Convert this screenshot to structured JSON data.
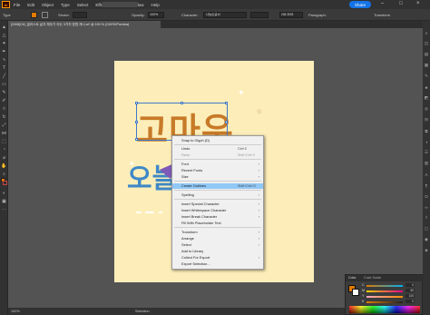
{
  "app": {
    "logo": "Ai"
  },
  "menubar": {
    "items": [
      "File",
      "Edit",
      "Object",
      "Type",
      "Select",
      "Effect",
      "View",
      "Window",
      "Help"
    ],
    "share_label": "Share"
  },
  "controlbar": {
    "type_label": "Type",
    "stroke_label": "Stroke:",
    "opacity_label": "Opacity:",
    "opacity_value": "100%",
    "character_label": "Character:",
    "font_value": "나눔손글씨",
    "size_value": "248.3533",
    "paragraph_label": "Paragraph:",
    "transform_label": "Transform",
    "fill_color": "#e07b00"
  },
  "document_tab": {
    "label": "[2308]CM_일러스트 글자 체우기 아는 3가지 방법 캐시.ai* @ 100 % (CMYK/Preview)"
  },
  "canvas": {
    "text_line1": "고마우",
    "text_line2": "오늘",
    "artboard_color": "#fdeeb9"
  },
  "context_menu": {
    "items": [
      {
        "label": "Snap to Glyph (D)",
        "shortcut": "",
        "arrow": false,
        "dim": false,
        "hl": false
      },
      {
        "label": "Undo",
        "shortcut": "Ctrl+Z",
        "arrow": false,
        "dim": false,
        "hl": false
      },
      {
        "label": "Redo",
        "shortcut": "Shift+Ctrl+Z",
        "arrow": false,
        "dim": true,
        "hl": false
      },
      {
        "label": "Font",
        "shortcut": "",
        "arrow": true,
        "dim": false,
        "hl": false
      },
      {
        "label": "Recent Fonts",
        "shortcut": "",
        "arrow": true,
        "dim": false,
        "hl": false
      },
      {
        "label": "Size",
        "shortcut": "",
        "arrow": true,
        "dim": false,
        "hl": false
      },
      {
        "label": "Create Outlines",
        "shortcut": "Shift+Ctrl+O",
        "arrow": false,
        "dim": false,
        "hl": true
      },
      {
        "label": "Spelling",
        "shortcut": "",
        "arrow": true,
        "dim": false,
        "hl": false
      },
      {
        "label": "Insert Special Character",
        "shortcut": "",
        "arrow": true,
        "dim": false,
        "hl": false
      },
      {
        "label": "Insert Whitespace Character",
        "shortcut": "",
        "arrow": true,
        "dim": false,
        "hl": false
      },
      {
        "label": "Insert Break Character",
        "shortcut": "",
        "arrow": true,
        "dim": false,
        "hl": false
      },
      {
        "label": "Fill With Placeholder Text",
        "shortcut": "",
        "arrow": false,
        "dim": false,
        "hl": false
      },
      {
        "label": "Transform",
        "shortcut": "",
        "arrow": true,
        "dim": false,
        "hl": false
      },
      {
        "label": "Arrange",
        "shortcut": "",
        "arrow": true,
        "dim": false,
        "hl": false
      },
      {
        "label": "Select",
        "shortcut": "",
        "arrow": true,
        "dim": false,
        "hl": false
      },
      {
        "label": "Add to Library",
        "shortcut": "",
        "arrow": false,
        "dim": false,
        "hl": false
      },
      {
        "label": "Collect For Export",
        "shortcut": "",
        "arrow": true,
        "dim": false,
        "hl": false
      },
      {
        "label": "Export Selection...",
        "shortcut": "",
        "arrow": false,
        "dim": false,
        "hl": false
      }
    ]
  },
  "status": {
    "zoom": "100%",
    "tool": "Selection"
  },
  "color_panel": {
    "tab_color": "Color",
    "tab_guide": "Color Guide",
    "sliders": [
      {
        "label": "C",
        "value": "0",
        "color": "#00aeef"
      },
      {
        "label": "M",
        "value": "60",
        "color": "#ec008c"
      },
      {
        "label": "Y",
        "value": "100",
        "color": "#fff200"
      },
      {
        "label": "K",
        "value": "0",
        "color": "#231f20"
      }
    ]
  }
}
